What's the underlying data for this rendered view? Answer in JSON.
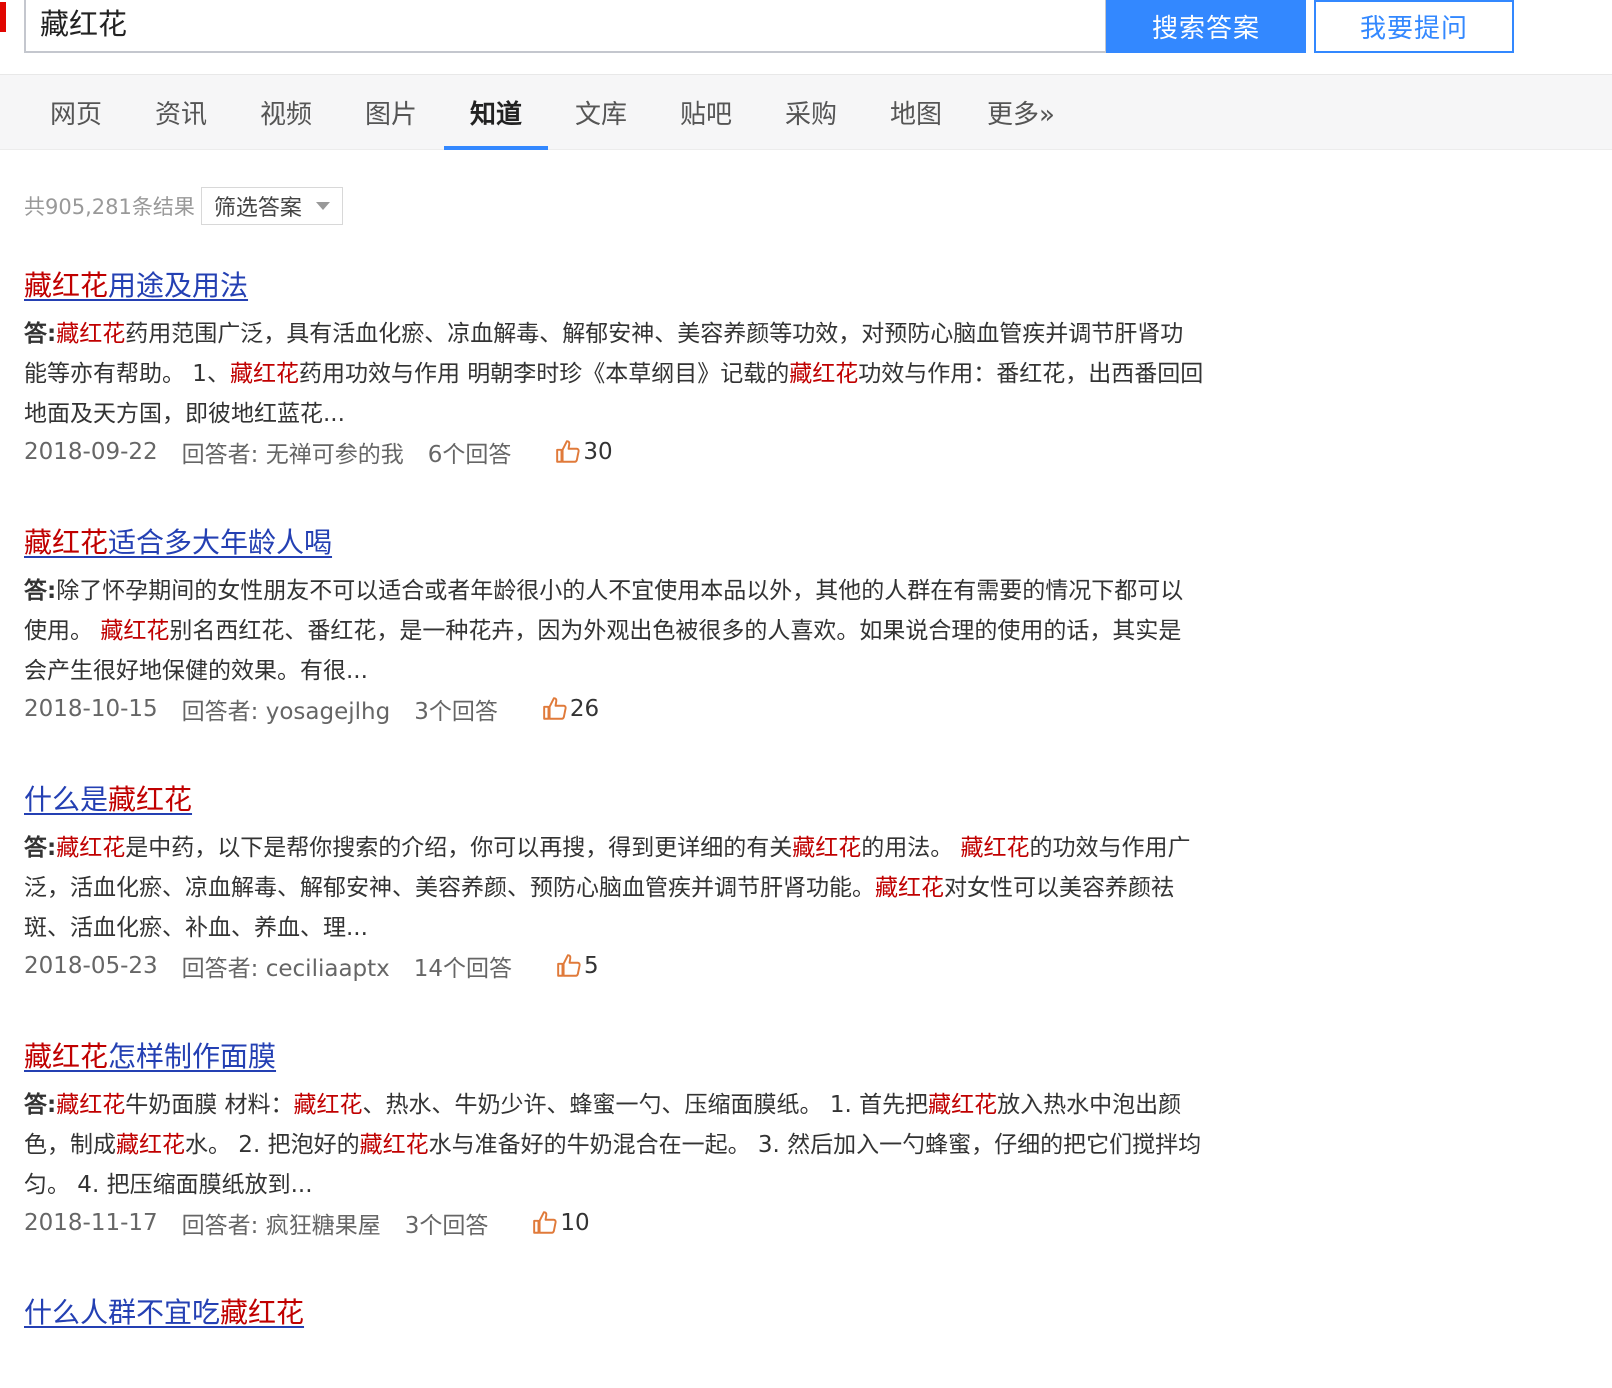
{
  "search": {
    "query": "藏红花",
    "search_button": "搜索答案",
    "ask_button": "我要提问"
  },
  "nav": {
    "tabs": [
      {
        "label": "网页"
      },
      {
        "label": "资讯"
      },
      {
        "label": "视频"
      },
      {
        "label": "图片"
      },
      {
        "label": "知道",
        "active": true
      },
      {
        "label": "文库"
      },
      {
        "label": "贴吧"
      },
      {
        "label": "采购"
      },
      {
        "label": "地图"
      },
      {
        "label": "更多»"
      }
    ]
  },
  "results_meta": {
    "count_text": "共905,281条结果",
    "filter_label": "筛选答案"
  },
  "answer_label": "答:",
  "results": [
    {
      "title_highlight": "藏红花",
      "title_rest": "用途及用法",
      "snippet": [
        {
          "t": "藏红花",
          "hl": true
        },
        {
          "t": "药用范围广泛，具有活血化瘀、凉血解毒、解郁安神、美容养颜等功效，对预防心脑血管疾并调节肝肾功能等亦有帮助。 1、"
        },
        {
          "t": "藏红花",
          "hl": true
        },
        {
          "t": "药用功效与作用 明朝李时珍《本草纲目》记载的"
        },
        {
          "t": "藏红花",
          "hl": true
        },
        {
          "t": "功效与作用：番红花，出西番回回地面及天方国，即彼地红蓝花..."
        }
      ],
      "date": "2018-09-22",
      "answerer": "回答者: 无禅可参的我",
      "answers": "6个回答",
      "likes": "30"
    },
    {
      "title_highlight": "藏红花",
      "title_rest": "适合多大年龄人喝",
      "snippet": [
        {
          "t": "除了怀孕期间的女性朋友不可以适合或者年龄很小的人不宜使用本品以外，其他的人群在有需要的情况下都可以使用。 "
        },
        {
          "t": "藏红花",
          "hl": true
        },
        {
          "t": "别名西红花、番红花，是一种花卉，因为外观出色被很多的人喜欢。如果说合理的使用的话，其实是会产生很好地保健的效果。有很..."
        }
      ],
      "date": "2018-10-15",
      "answerer": "回答者: yosagejlhg",
      "answers": "3个回答",
      "likes": "26"
    },
    {
      "title_prefix": "什么是",
      "title_highlight": "藏红花",
      "snippet": [
        {
          "t": "藏红花",
          "hl": true
        },
        {
          "t": "是中药，以下是帮你搜索的介绍，你可以再搜，得到更详细的有关"
        },
        {
          "t": "藏红花",
          "hl": true
        },
        {
          "t": "的用法。 "
        },
        {
          "t": "藏红花",
          "hl": true
        },
        {
          "t": "的功效与作用广泛，活血化瘀、凉血解毒、解郁安神、美容养颜、预防心脑血管疾并调节肝肾功能。"
        },
        {
          "t": "藏红花",
          "hl": true
        },
        {
          "t": "对女性可以美容养颜祛斑、活血化瘀、补血、养血、理..."
        }
      ],
      "date": "2018-05-23",
      "answerer": "回答者: ceciliaaptx",
      "answers": "14个回答",
      "likes": "5"
    },
    {
      "title_highlight": "藏红花",
      "title_rest": "怎样制作面膜",
      "snippet": [
        {
          "t": "藏红花",
          "hl": true
        },
        {
          "t": "牛奶面膜 材料："
        },
        {
          "t": "藏红花",
          "hl": true
        },
        {
          "t": "、热水、牛奶少许、蜂蜜一勺、压缩面膜纸。 1. 首先把"
        },
        {
          "t": "藏红花",
          "hl": true
        },
        {
          "t": "放入热水中泡出颜色，制成"
        },
        {
          "t": "藏红花",
          "hl": true
        },
        {
          "t": "水。 2. 把泡好的"
        },
        {
          "t": "藏红花",
          "hl": true
        },
        {
          "t": "水与准备好的牛奶混合在一起。 3. 然后加入一勺蜂蜜，仔细的把它们搅拌均匀。 4. 把压缩面膜纸放到..."
        }
      ],
      "date": "2018-11-17",
      "answerer": "回答者: 疯狂糖果屋",
      "answers": "3个回答",
      "likes": "10"
    },
    {
      "title_prefix": "什么人群不宜吃",
      "title_highlight": "藏红花"
    }
  ]
}
